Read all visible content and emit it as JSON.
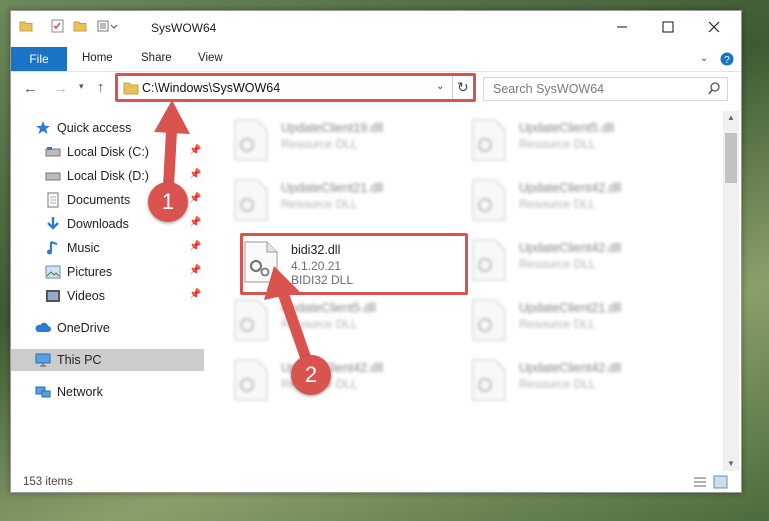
{
  "window": {
    "title": "SysWOW64"
  },
  "ribbon": {
    "tabs": [
      "File",
      "Home",
      "Share",
      "View"
    ]
  },
  "address": {
    "path": "C:\\Windows\\SysWOW64"
  },
  "search": {
    "placeholder": "Search SysWOW64"
  },
  "nav": {
    "quick_access": "Quick access",
    "items": [
      {
        "label": "Local Disk (C:)",
        "icon": "drive-icon"
      },
      {
        "label": "Local Disk (D:)",
        "icon": "drive-icon"
      },
      {
        "label": "Documents",
        "icon": "documents-icon"
      },
      {
        "label": "Downloads",
        "icon": "downloads-icon"
      },
      {
        "label": "Music",
        "icon": "music-icon"
      },
      {
        "label": "Pictures",
        "icon": "pictures-icon"
      },
      {
        "label": "Videos",
        "icon": "videos-icon"
      }
    ],
    "onedrive": "OneDrive",
    "this_pc": "This PC",
    "network": "Network"
  },
  "files": [
    {
      "name": "UpdateClient19.dll",
      "type": "Resource DLL"
    },
    {
      "name": "UpdateClient5.dll",
      "type": "Resource DLL"
    },
    {
      "name": "UpdateClient21.dll",
      "type": "Resource DLL"
    },
    {
      "name": "UpdateClient42.dll",
      "type": "Resource DLL"
    },
    {
      "name": "bidi32.dll",
      "version": "4.1.20.21",
      "type": "BIDI32 DLL"
    },
    {
      "name": "UpdateClient42.dll",
      "type": "Resource DLL"
    },
    {
      "name": "UpdateClient5.dll",
      "type": "Resource DLL"
    },
    {
      "name": "UpdateClient21.dll",
      "type": "Resource DLL"
    },
    {
      "name": "UpdateClient42.dll",
      "type": "Resource DLL"
    },
    {
      "name": "UpdateClient42.dll",
      "type": "Resource DLL"
    }
  ],
  "status": {
    "count": "153 items"
  },
  "annotations": {
    "step1": "1",
    "step2": "2"
  },
  "colors": {
    "accent": "#1a73c5",
    "highlight": "#d9534f"
  }
}
